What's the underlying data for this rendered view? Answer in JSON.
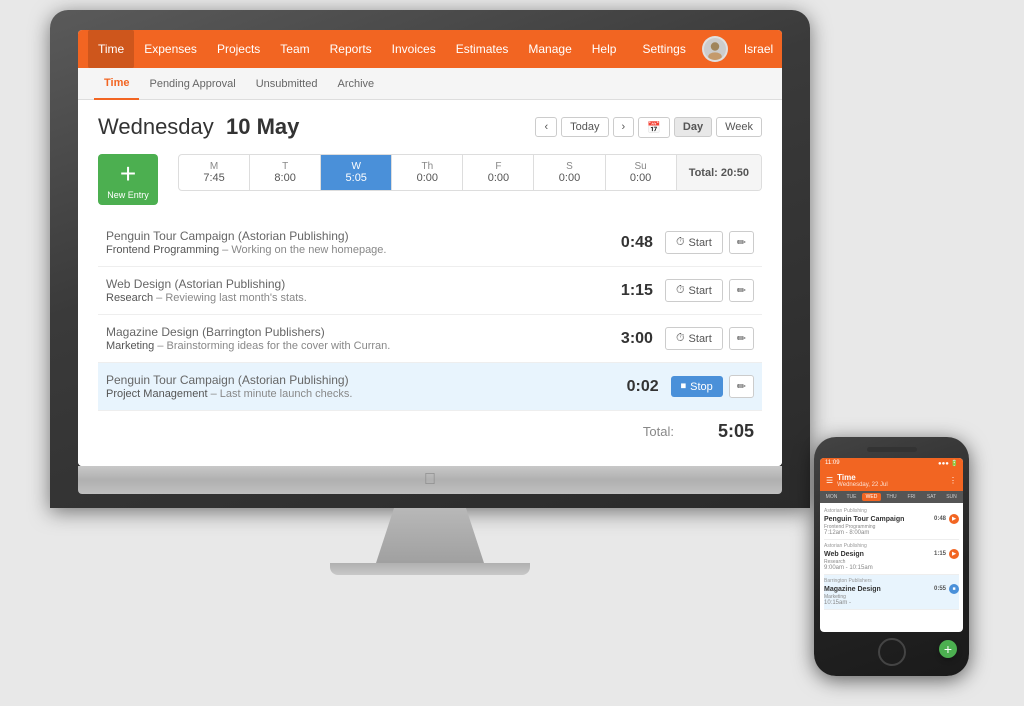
{
  "nav": {
    "items": [
      "Time",
      "Expenses",
      "Projects",
      "Team",
      "Reports",
      "Invoices",
      "Estimates",
      "Manage"
    ],
    "active": "Time",
    "right_items": [
      "Help",
      "Settings"
    ],
    "user": "Israel"
  },
  "sub_nav": {
    "items": [
      "Time",
      "Pending Approval",
      "Unsubmitted",
      "Archive"
    ],
    "active": "Time"
  },
  "calendar": {
    "day_label": "Wednesday",
    "date_label": "10 May",
    "nav_buttons": [
      "<",
      "Today",
      ">"
    ],
    "view_buttons": [
      "Day",
      "Week"
    ],
    "week_days": [
      {
        "label": "M",
        "time": "7:45"
      },
      {
        "label": "T",
        "time": "8:00"
      },
      {
        "label": "W",
        "time": "5:05",
        "today": true
      },
      {
        "label": "Th",
        "time": "0:00"
      },
      {
        "label": "F",
        "time": "0:00"
      },
      {
        "label": "S",
        "time": "0:00"
      },
      {
        "label": "Su",
        "time": "0:00"
      }
    ],
    "week_total": "Total: 20:50"
  },
  "new_entry": {
    "label": "New Entry",
    "plus": "+"
  },
  "entries": [
    {
      "id": 1,
      "project": "Penguin Tour Campaign",
      "client": "Astorian Publishing",
      "category": "Frontend Programming",
      "description": "Working on the new homepage.",
      "time": "0:48",
      "action": "Start",
      "active": false
    },
    {
      "id": 2,
      "project": "Web Design",
      "client": "Astorian Publishing",
      "category": "Research",
      "description": "Reviewing last month's stats.",
      "time": "1:15",
      "action": "Start",
      "active": false
    },
    {
      "id": 3,
      "project": "Magazine Design",
      "client": "Barrington Publishers",
      "category": "Marketing",
      "description": "Brainstorming ideas for the cover with Curran.",
      "time": "3:00",
      "action": "Start",
      "active": false
    },
    {
      "id": 4,
      "project": "Penguin Tour Campaign",
      "client": "Astorian Publishing",
      "category": "Project Management",
      "description": "Last minute launch checks.",
      "time": "0:02",
      "action": "Stop",
      "active": true
    }
  ],
  "total_label": "Total:",
  "total_value": "5:05",
  "iphone": {
    "title": "Time",
    "subtitle": "Wednesday, 22 Jul",
    "week_days": [
      "MON",
      "TUE",
      "WED",
      "THU",
      "FRI",
      "SAT",
      "SUN"
    ],
    "today_index": 2,
    "entries": [
      {
        "publisher": "Astorian Publishing",
        "title": "Penguin Tour Campaign",
        "sub": "Frontend Programming",
        "time": "0:48",
        "time_range": "7:12am - 8:00am",
        "playing": false
      },
      {
        "publisher": "Astorian Publishing",
        "title": "Web Design",
        "sub": "Research",
        "time": "1:15",
        "time_range": "9:00am - 10:15am",
        "playing": false
      },
      {
        "publisher": "Barrington Publishers",
        "title": "Magazine Design",
        "sub": "Marketing",
        "time": "0:55",
        "time_range": "10:15am -",
        "playing": true
      }
    ]
  }
}
